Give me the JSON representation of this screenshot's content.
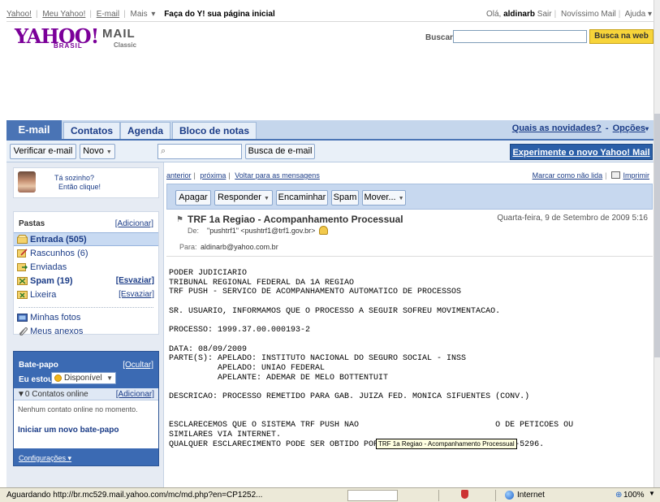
{
  "universal_header": {
    "links": [
      "Yahoo!",
      "Meu Yahoo!",
      "E-mail",
      "Mais"
    ],
    "make_home": "Faça do Y! sua página inicial",
    "greeting_prefix": "Olá,",
    "username": "aldinarb",
    "signout": "Sair",
    "newest_mail": "Novíssimo Mail",
    "help": "Ajuda"
  },
  "logo": {
    "yahoo": "YAHOO!",
    "brasil": "BRASIL",
    "mail": "MAIL",
    "classic": "Classic"
  },
  "search": {
    "label": "Buscar:",
    "value": "",
    "web_button": "Busca na web"
  },
  "tabs": {
    "email": "E-mail",
    "contacts": "Contatos",
    "calendar": "Agenda",
    "notepad": "Bloco de notas"
  },
  "whatsnew": {
    "news": "Quais as novidades?",
    "dash": "-",
    "options": "Opções"
  },
  "toolbar": {
    "check_mail": "Verificar e-mail",
    "new": "Novo",
    "search_placeholder": "",
    "search_mail": "Busca de e-mail",
    "try_new": "Experimente o novo Yahoo! Mail"
  },
  "chat_promo": {
    "line1": "Tá sozinho?",
    "line2": "Então clique!"
  },
  "folders": {
    "title": "Pastas",
    "add": "[Adicionar]",
    "inbox": "Entrada (505)",
    "drafts": "Rascunhos (6)",
    "sent": "Enviadas",
    "spam": "Spam (19)",
    "spam_action": "[Esvaziar]",
    "trash": "Lixeira",
    "trash_action": "[Esvaziar]",
    "photos": "Minhas fotos",
    "attachments": "Meus anexos"
  },
  "im": {
    "title": "Bate-papo",
    "hide": "[Ocultar]",
    "status_label": "Eu estou",
    "status": "Disponível",
    "contacts_label": "▼0 Contatos online",
    "contacts_add": "[Adicionar]",
    "none_online": "Nenhum contato online no momento.",
    "start_chat": "Iniciar um novo bate-papo",
    "settings": "Configurações"
  },
  "message_nav": {
    "previous": "anterior",
    "next": "próxima",
    "back": "Voltar para as mensagens",
    "mark_unread": "Marcar como não lida",
    "print": "Imprimir"
  },
  "message_actions": {
    "delete": "Apagar",
    "reply": "Responder",
    "forward": "Encaminhar",
    "spam": "Spam",
    "move": "Mover..."
  },
  "message": {
    "subject": "TRF 1a Regiao - Acompanhamento Processual",
    "date": "Quarta-feira, 9 de Setembro de 2009 5:16",
    "from_label": "De:",
    "from": "\"pushtrf1\" <pushtrf1@trf1.gov.br>",
    "to_label": "Para:",
    "to": "aldinarb@yahoo.com.br",
    "body": "PODER JUDICIARIO\nTRIBUNAL REGIONAL FEDERAL DA 1A REGIAO\nTRF PUSH - SERVICO DE ACOMPANHAMENTO AUTOMATICO DE PROCESSOS\n\nSR. USUARIO, INFORMAMOS QUE O PROCESSO A SEGUIR SOFREU MOVIMENTACAO.\n\nPROCESSO: 1999.37.00.000193-2\n\nDATA: 08/09/2009\nPARTE(S): APELADO: INSTITUTO NACIONAL DO SEGURO SOCIAL - INSS\n          APELADO: UNIAO FEDERAL\n          APELANTE: ADEMAR DE MELO BOTTENTUIT\n\nDESCRICAO: PROCESSO REMETIDO PARA GAB. JUIZA FED. MONICA SIFUENTES (CONV.)\n\n\nESCLARECEMOS QUE O SISTEMA TRF PUSH NAO                            O DE PETICOES OU\nSIMILARES VIA INTERNET.\nQUALQUER ESCLARECIMENTO PODE SER OBTIDO POR MEIO DO TELEFONE (061) 3314-5296.",
    "tooltip": "TRF 1a Regiao - Acompanhamento Processual"
  },
  "statusbar": {
    "text": "Aguardando http://br.mc529.mail.yahoo.com/mc/md.php?en=CP1252...",
    "zone": "Internet",
    "zoom": "100%"
  },
  "colors": {
    "yahoo_purple": "#7b0099",
    "tab_blue": "#4a74b5",
    "accent_yellow": "#f7d43a"
  }
}
